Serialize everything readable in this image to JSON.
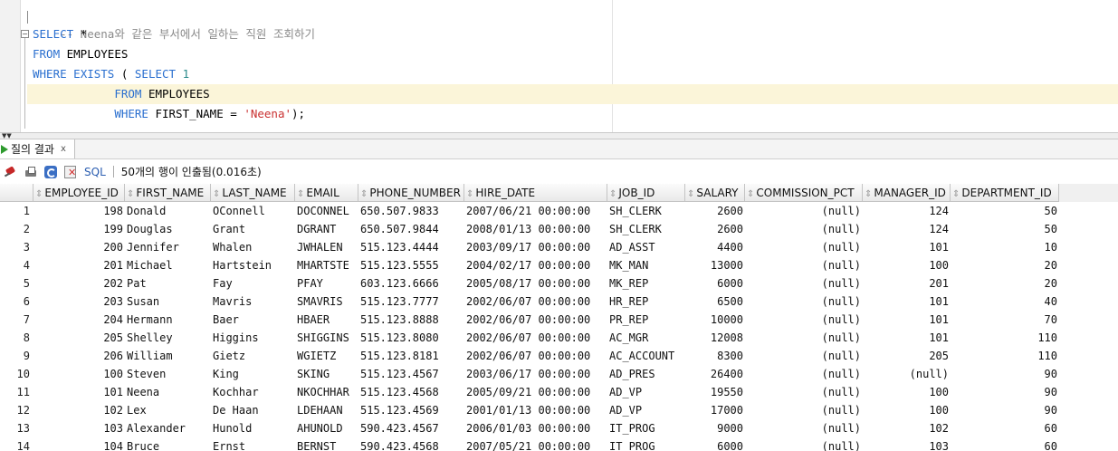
{
  "editor": {
    "comment": "-- Neena와 같은 부서에서 일하는 직원 조회하기",
    "fold_glyph": "−",
    "tokens": {
      "select": "SELECT",
      "star": " *",
      "from": "FROM",
      "employees": " EMPLOYEES",
      "where": "WHERE",
      "exists": "EXISTS",
      "paren": " ( ",
      "one": "1",
      "indent": "            ",
      "first_name_cond": " FIRST_NAME = ",
      "neena_str": "'Neena'",
      "close": ");"
    }
  },
  "results_tab": {
    "label": "질의 결과",
    "close": "x"
  },
  "toolbar": {
    "sql_label": "SQL",
    "status": "50개의 행이 인출됨(0.016초)"
  },
  "grid": {
    "sort_glyph": "⇕",
    "columns": [
      "EMPLOYEE_ID",
      "FIRST_NAME",
      "LAST_NAME",
      "EMAIL",
      "PHONE_NUMBER",
      "HIRE_DATE",
      "JOB_ID",
      "SALARY",
      "COMMISSION_PCT",
      "MANAGER_ID",
      "DEPARTMENT_ID"
    ],
    "rows": [
      [
        "1",
        "198",
        "Donald",
        "OConnell",
        "DOCONNEL",
        "650.507.9833",
        "2007/06/21 00:00:00",
        "SH_CLERK",
        "2600",
        "(null)",
        "124",
        "50"
      ],
      [
        "2",
        "199",
        "Douglas",
        "Grant",
        "DGRANT",
        "650.507.9844",
        "2008/01/13 00:00:00",
        "SH_CLERK",
        "2600",
        "(null)",
        "124",
        "50"
      ],
      [
        "3",
        "200",
        "Jennifer",
        "Whalen",
        "JWHALEN",
        "515.123.4444",
        "2003/09/17 00:00:00",
        "AD_ASST",
        "4400",
        "(null)",
        "101",
        "10"
      ],
      [
        "4",
        "201",
        "Michael",
        "Hartstein",
        "MHARTSTE",
        "515.123.5555",
        "2004/02/17 00:00:00",
        "MK_MAN",
        "13000",
        "(null)",
        "100",
        "20"
      ],
      [
        "5",
        "202",
        "Pat",
        "Fay",
        "PFAY",
        "603.123.6666",
        "2005/08/17 00:00:00",
        "MK_REP",
        "6000",
        "(null)",
        "201",
        "20"
      ],
      [
        "6",
        "203",
        "Susan",
        "Mavris",
        "SMAVRIS",
        "515.123.7777",
        "2002/06/07 00:00:00",
        "HR_REP",
        "6500",
        "(null)",
        "101",
        "40"
      ],
      [
        "7",
        "204",
        "Hermann",
        "Baer",
        "HBAER",
        "515.123.8888",
        "2002/06/07 00:00:00",
        "PR_REP",
        "10000",
        "(null)",
        "101",
        "70"
      ],
      [
        "8",
        "205",
        "Shelley",
        "Higgins",
        "SHIGGINS",
        "515.123.8080",
        "2002/06/07 00:00:00",
        "AC_MGR",
        "12008",
        "(null)",
        "101",
        "110"
      ],
      [
        "9",
        "206",
        "William",
        "Gietz",
        "WGIETZ",
        "515.123.8181",
        "2002/06/07 00:00:00",
        "AC_ACCOUNT",
        "8300",
        "(null)",
        "205",
        "110"
      ],
      [
        "10",
        "100",
        "Steven",
        "King",
        "SKING",
        "515.123.4567",
        "2003/06/17 00:00:00",
        "AD_PRES",
        "26400",
        "(null)",
        "(null)",
        "90"
      ],
      [
        "11",
        "101",
        "Neena",
        "Kochhar",
        "NKOCHHAR",
        "515.123.4568",
        "2005/09/21 00:00:00",
        "AD_VP",
        "19550",
        "(null)",
        "100",
        "90"
      ],
      [
        "12",
        "102",
        "Lex",
        "De Haan",
        "LDEHAAN",
        "515.123.4569",
        "2001/01/13 00:00:00",
        "AD_VP",
        "17000",
        "(null)",
        "100",
        "90"
      ],
      [
        "13",
        "103",
        "Alexander",
        "Hunold",
        "AHUNOLD",
        "590.423.4567",
        "2006/01/03 00:00:00",
        "IT_PROG",
        "9000",
        "(null)",
        "102",
        "60"
      ],
      [
        "14",
        "104",
        "Bruce",
        "Ernst",
        "BERNST",
        "590.423.4568",
        "2007/05/21 00:00:00",
        "IT_PROG",
        "6000",
        "(null)",
        "103",
        "60"
      ]
    ]
  }
}
